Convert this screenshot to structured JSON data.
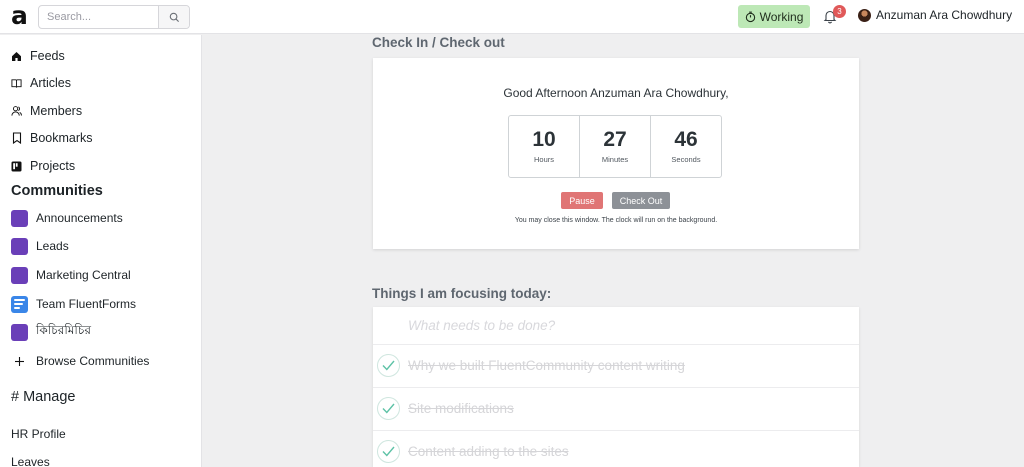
{
  "topbar": {
    "logo_icon": "brand-logo-icon",
    "logo_text": "a",
    "search_placeholder": "Search...",
    "search_icon": "search-icon",
    "status_label": "Working",
    "status_icon": "stopwatch-icon",
    "status_color": "#bde8b6",
    "notifications_icon": "bell-icon",
    "notifications_count": "3",
    "user_name": "Anzuman Ara Chowdhury"
  },
  "sidebar": {
    "nav": [
      {
        "label": "Feeds",
        "icon": "home-icon"
      },
      {
        "label": "Articles",
        "icon": "book-icon"
      },
      {
        "label": "Members",
        "icon": "members-icon"
      },
      {
        "label": "Bookmarks",
        "icon": "bookmark-icon"
      },
      {
        "label": "Projects",
        "icon": "kanban-icon"
      }
    ],
    "communities_title": "Communities",
    "communities": [
      {
        "label": "Announcements",
        "color": "#6a3fb8"
      },
      {
        "label": "Leads",
        "color": "#6a3fb8"
      },
      {
        "label": "Marketing Central",
        "color": "#6a3fb8"
      },
      {
        "label": "Team FluentForms",
        "color": "#3a86e8"
      },
      {
        "label": "কিচিরমিচির",
        "color": "#6a3fb8"
      }
    ],
    "browse_label": "Browse Communities",
    "manage_title": "# Manage",
    "manage_items": [
      "HR Profile",
      "Leaves"
    ]
  },
  "checkin": {
    "heading": "Check In / Check out",
    "greeting": "Good Afternoon Anzuman Ara Chowdhury,",
    "hours": "10",
    "hours_label": "Hours",
    "minutes": "27",
    "minutes_label": "Minutes",
    "seconds": "46",
    "seconds_label": "Seconds",
    "pause_label": "Pause",
    "checkout_label": "Check Out",
    "note": "You may close this window. The clock will run on the background."
  },
  "focus": {
    "heading": "Things I am focusing today:",
    "input_placeholder": "What needs to be done?",
    "items": [
      {
        "text": "Why we built FluentCommunity content writing",
        "done": true
      },
      {
        "text": "Site modifications",
        "done": true
      },
      {
        "text": "Content adding to the sites",
        "done": true
      }
    ]
  }
}
